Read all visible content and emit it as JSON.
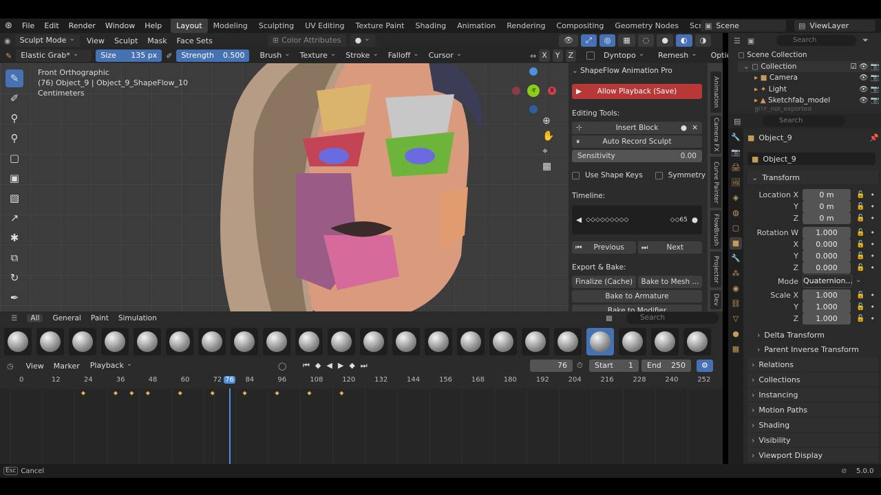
{
  "app": {
    "menu": [
      "File",
      "Edit",
      "Render",
      "Window",
      "Help"
    ],
    "workspaces": [
      "Layout",
      "Modeling",
      "Sculpting",
      "UV Editing",
      "Texture Paint",
      "Shading",
      "Animation",
      "Rendering",
      "Compositing",
      "Geometry Nodes",
      "Scripting"
    ],
    "active_workspace": "Layout",
    "scene": "Scene",
    "view_layer": "ViewLayer",
    "version": "5.0.0"
  },
  "viewport_header": {
    "mode": "Sculpt Mode",
    "menus": [
      "View",
      "Sculpt",
      "Mask",
      "Face Sets"
    ],
    "color_attributes": "Color Attributes",
    "axes": [
      "X",
      "Y",
      "Z"
    ]
  },
  "tool_settings": {
    "brush": "Elastic Grab*",
    "size_label": "Size",
    "size_value": "135 px",
    "strength_label": "Strength",
    "strength_value": "0.500",
    "menus": [
      "Brush",
      "Texture",
      "Stroke",
      "Falloff",
      "Cursor"
    ],
    "dyntopo": "Dyntopo",
    "remesh": "Remesh",
    "options": "Options"
  },
  "viewport": {
    "view_name": "Front Orthographic",
    "object_line": "(76) Object_9 | Object_9_ShapeFlow_10",
    "units": "Centimeters",
    "gizmo_y": "-Y"
  },
  "npanel": {
    "title": "ShapeFlow Animation Pro",
    "allow_playback": "Allow Playback (Save)",
    "editing_tools": "Editing Tools:",
    "insert_block": "Insert Block",
    "auto_record": "Auto Record Sculpt",
    "sensitivity_label": "Sensitivity",
    "sensitivity_value": "0.00",
    "use_shape_keys": "Use Shape Keys",
    "symmetry": "Symmetry",
    "timeline_label": "Timeline:",
    "timeline_diamonds": "◇◇◇◇◇◇◇◇◇",
    "timeline_frame": "◇◇65",
    "previous": "Previous",
    "next": "Next",
    "export_label": "Export & Bake:",
    "finalize": "Finalize (Cache)",
    "bake_mesh": "Bake to Mesh ...",
    "bake_armature": "Bake to Armature",
    "bake_modifier": "Bake to Modifier"
  },
  "side_tabs": [
    "Animation",
    "Camera FX",
    "Curve Painter",
    "FlowBrush",
    "Projector",
    "Dev"
  ],
  "brush_bar": {
    "tabs": [
      "All",
      "General",
      "Paint",
      "Simulation"
    ],
    "active_tab": "All",
    "search_placeholder": "Search"
  },
  "timeline": {
    "menus": [
      "View",
      "Marker",
      "Playback"
    ],
    "current_frame": "76",
    "start_label": "Start",
    "start": "1",
    "end_label": "End",
    "end": "250",
    "ticks": [
      "0",
      "12",
      "24",
      "36",
      "48",
      "60",
      "72",
      "76",
      "84",
      "96",
      "108",
      "120",
      "132",
      "144",
      "156",
      "168",
      "180",
      "192",
      "204",
      "216",
      "228",
      "240",
      "252"
    ],
    "keyframes": [
      12,
      24,
      30,
      36,
      48,
      60,
      72,
      84,
      96,
      108
    ],
    "keyframe_count": 10
  },
  "status": {
    "key": "Esc",
    "action": "Cancel"
  },
  "outliner": {
    "search_placeholder": "Search",
    "root": "Scene Collection",
    "collection": "Collection",
    "items": [
      "Camera",
      "Light",
      "Sketchfab_model"
    ],
    "cut_item": "glTF_not_exported"
  },
  "properties": {
    "search_placeholder": "Search",
    "object_name": "Object_9",
    "object_field": "Object_9",
    "transform": "Transform",
    "location_label": "Location X",
    "rotation_label": "Rotation W",
    "loc": [
      "0 m",
      "0 m",
      "0 m"
    ],
    "rot": [
      "1.000",
      "0.000",
      "0.000",
      "0.000"
    ],
    "mode_label": "Mode",
    "mode_value": "Quaternion...",
    "scale_label": "Scale X",
    "scale": [
      "1.000",
      "1.000",
      "1.000"
    ],
    "y": "Y",
    "z": "Z",
    "x": "X",
    "subsections": [
      "Delta Transform",
      "Parent Inverse Transform"
    ],
    "sections": [
      "Relations",
      "Collections",
      "Instancing",
      "Motion Paths",
      "Shading",
      "Visibility",
      "Viewport Display"
    ]
  },
  "colors": {
    "accent_blue": "#4672b3",
    "record_red": "#b83737",
    "keyframe": "#e2b34a",
    "playhead": "#4d8fe0"
  }
}
